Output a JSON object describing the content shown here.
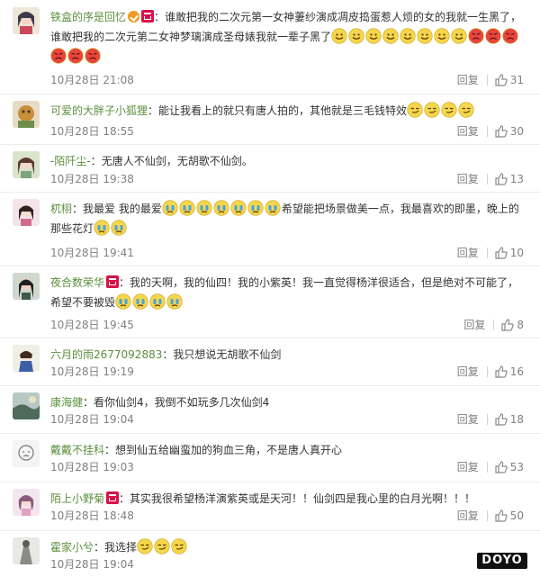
{
  "comments": [
    {
      "username": "铁盒的序是回忆",
      "badges": [
        "vip",
        "shop"
      ],
      "text": "谁敢把我的二次元第一女神萋纱演成凋皮捣蛋惹人烦的女的我就一生黑了，谁敢把我的二次元第二女神梦璃演成圣母婊我就一辈子黑了",
      "emojis": [
        "smile",
        "smile",
        "smile",
        "smile",
        "smile",
        "smile",
        "smile",
        "smile",
        "angry",
        "angry",
        "angry",
        "angry",
        "angry",
        "angry"
      ],
      "date": "10月28日 21:08",
      "reply": "回复",
      "likes": "31"
    },
    {
      "username": "可爱的大胖子小狐狸",
      "badges": [],
      "text": "能让我看上的就只有唐人拍的，其他就是三毛钱特效",
      "emojis": [
        "smirk",
        "smirk",
        "smirk",
        "smirk"
      ],
      "date": "10月28日 18:55",
      "reply": "回复",
      "likes": "30"
    },
    {
      "username": "-陌阡尘-",
      "badges": [],
      "text": "无唐人不仙剑，无胡歌不仙剑。",
      "emojis": [],
      "date": "10月28日 19:38",
      "reply": "回复",
      "likes": "13"
    },
    {
      "username": "杌栩",
      "badges": [],
      "text": "我最爱 我的最爱",
      "emojis_mid": [
        "cry",
        "cry",
        "cry",
        "cry",
        "cry",
        "cry",
        "cry"
      ],
      "text_after": "希望能把场景做美一点，我最喜欢的即墨，晚上的那些花灯",
      "emojis": [
        "cry",
        "cry"
      ],
      "date": "10月28日 19:41",
      "reply": "回复",
      "likes": "10"
    },
    {
      "username": "夜合数荣华",
      "badges": [
        "shop"
      ],
      "text": "我的天啊，我的仙四！我的小紫英！我一直觉得杨洋很适合，但是绝对不可能了，希望不要被毁",
      "emojis": [
        "cry",
        "cry",
        "cry",
        "cry"
      ],
      "date": "10月28日 19:45",
      "reply": "回复",
      "likes": "8"
    },
    {
      "username": "六月的雨2677092883",
      "badges": [],
      "text": "我只想说无胡歌不仙剑",
      "emojis": [],
      "date": "10月28日 19:19",
      "reply": "回复",
      "likes": "16"
    },
    {
      "username": "康海健",
      "badges": [],
      "text": "看你仙剑4，我倒不如玩多几次仙剑4",
      "emojis": [],
      "date": "10月28日 19:04",
      "reply": "回复",
      "likes": "18"
    },
    {
      "username": "戴戴不挂科",
      "badges": [],
      "text": "想到仙五给幽蛮加的狗血三角，不是唐人真开心",
      "emojis": [],
      "date": "10月28日 19:03",
      "reply": "回复",
      "likes": "53"
    },
    {
      "username": "陌上小野菊",
      "badges": [
        "shop"
      ],
      "text": "其实我很希望杨洋演紫英或是天河！！仙剑四是我心里的白月光啊！！！",
      "emojis": [],
      "date": "10月28日 18:48",
      "reply": "回复",
      "likes": "50"
    },
    {
      "username": "霍家小兮",
      "badges": [],
      "text": "我选择",
      "emojis": [
        "smirk",
        "smirk",
        "smirk"
      ],
      "date": "10月28日 19:04",
      "reply": "",
      "likes": ""
    }
  ],
  "watermark": "DOYO",
  "colors": {
    "username": "#5a8f3c",
    "meta": "#808080",
    "emoji_face": "#f6d64a",
    "emoji_angry": "#e8453c",
    "divider": "#ececec"
  }
}
